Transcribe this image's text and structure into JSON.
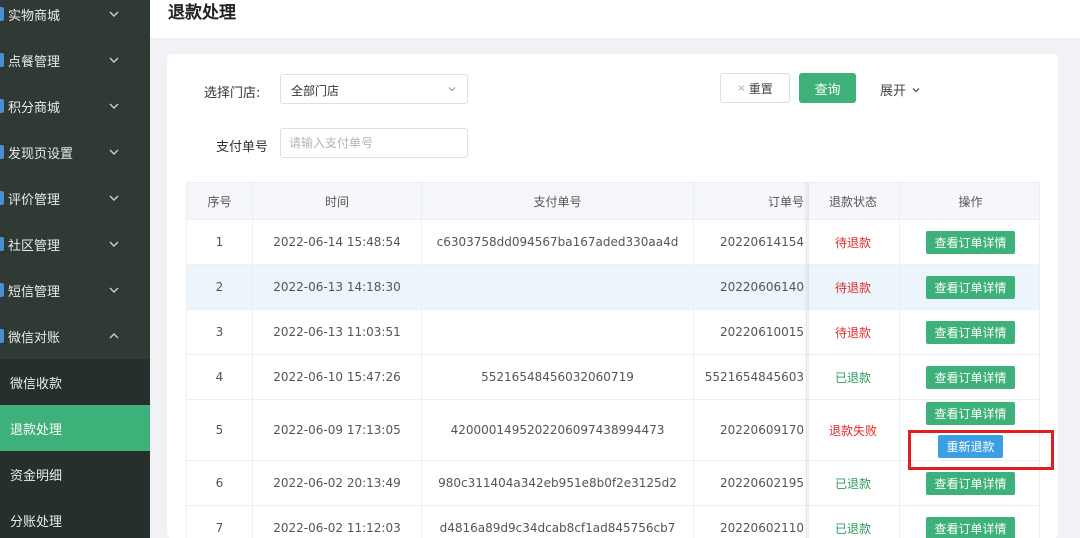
{
  "sidebar": {
    "items": [
      {
        "label": "实物商城",
        "expanded": false
      },
      {
        "label": "点餐管理",
        "expanded": false
      },
      {
        "label": "积分商城",
        "expanded": false
      },
      {
        "label": "发现页设置",
        "expanded": false
      },
      {
        "label": "评价管理",
        "expanded": false
      },
      {
        "label": "社区管理",
        "expanded": false
      },
      {
        "label": "短信管理",
        "expanded": false
      },
      {
        "label": "微信对账",
        "expanded": true
      }
    ],
    "subitems": [
      {
        "label": "微信收款",
        "active": false
      },
      {
        "label": "退款处理",
        "active": true
      },
      {
        "label": "资金明细",
        "active": false
      },
      {
        "label": "分账处理",
        "active": false
      }
    ]
  },
  "header": {
    "title": "退款处理"
  },
  "filters": {
    "store_label": "选择门店:",
    "store_value": "全部门店",
    "payno_label": "支付单号",
    "payno_placeholder": "请输入支付单号",
    "reset_label": "重置",
    "search_label": "查询",
    "expand_label": "展开"
  },
  "table": {
    "columns": [
      "序号",
      "时间",
      "支付单号",
      "订单号",
      "退款状态",
      "操作"
    ],
    "rows": [
      {
        "index": "1",
        "time": "2022-06-14 15:48:54",
        "pay_no": "c6303758dd094567ba167aded330aa4d",
        "order_no": "20220614154",
        "status": "待退款",
        "status_color": "red",
        "ops": [
          "查看订单详情"
        ]
      },
      {
        "index": "2",
        "time": "2022-06-13 14:18:30",
        "pay_no": "",
        "order_no": "20220606140",
        "status": "待退款",
        "status_color": "red",
        "ops": [
          "查看订单详情"
        ]
      },
      {
        "index": "3",
        "time": "2022-06-13 11:03:51",
        "pay_no": "",
        "order_no": "20220610015",
        "status": "待退款",
        "status_color": "red",
        "ops": [
          "查看订单详情"
        ]
      },
      {
        "index": "4",
        "time": "2022-06-10 15:47:26",
        "pay_no": "55216548456032060719",
        "order_no": "5521654845603",
        "status": "已退款",
        "status_color": "green",
        "ops": [
          "查看订单详情"
        ]
      },
      {
        "index": "5",
        "time": "2022-06-09 17:13:05",
        "pay_no": "420000149520220609743899447​3",
        "order_no": "20220609170",
        "status": "退款失败",
        "status_color": "red",
        "ops": [
          "查看订单详情",
          "重新退款"
        ]
      },
      {
        "index": "6",
        "time": "2022-06-02 20:13:49",
        "pay_no": "980c311404a342eb951e8b0f2e3125d2",
        "order_no": "20220602195",
        "status": "已退款",
        "status_color": "green",
        "ops": [
          "查看订单详情"
        ]
      },
      {
        "index": "7",
        "time": "2022-06-02 11:12:03",
        "pay_no": "d4816a89d9c34dcab8cf1ad845756cb7",
        "order_no": "20220602110",
        "status": "已退款",
        "status_color": "green",
        "ops": [
          "查看订单详情"
        ]
      }
    ]
  },
  "colors": {
    "accent": "#3eb17a",
    "sidebar": "#2f3a35",
    "danger": "#e02b2b",
    "info": "#3a9fe3"
  }
}
